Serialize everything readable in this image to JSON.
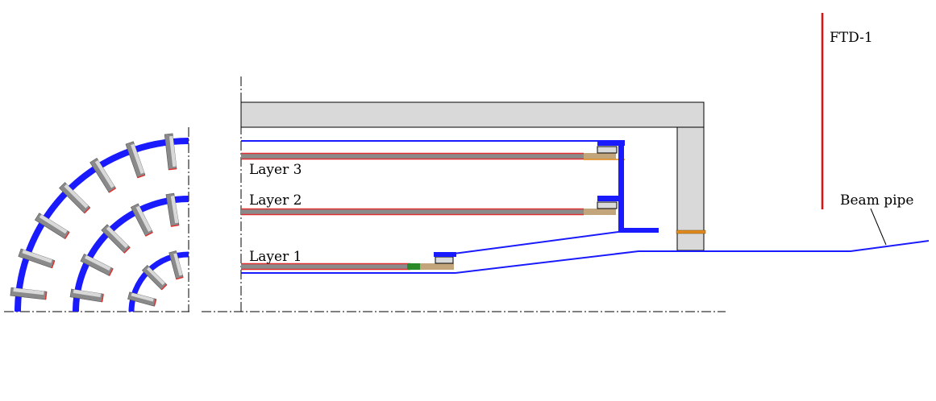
{
  "labels": {
    "ftd": "FTD-1",
    "beam_pipe": "Beam pipe",
    "layer1": "Layer 1",
    "layer2": "Layer 2",
    "layer3": "Layer 3"
  },
  "colors": {
    "support_blue": "#1a1aff",
    "sensor_red": "#e03030",
    "ladder_gray": "#8a8a8a",
    "tan": "#c2a57a",
    "structure_fill": "#d9d9d9",
    "ftd_red": "#e01010",
    "ring_orange": "#e08a1e",
    "connector_green": "#2a8a2a"
  }
}
